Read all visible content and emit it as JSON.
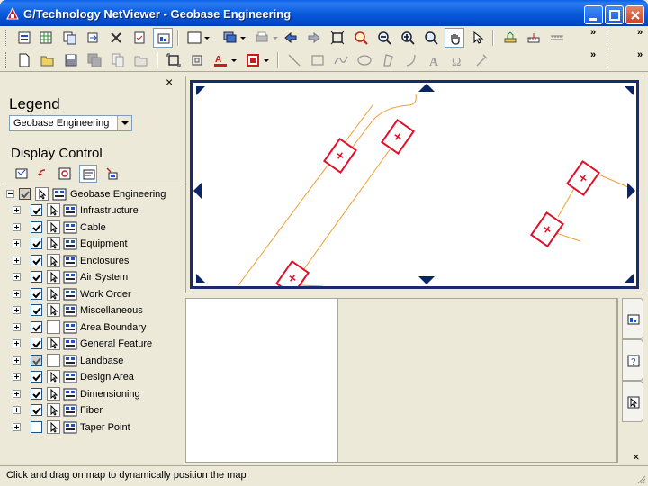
{
  "window": {
    "title": "G/Technology NetViewer - Geobase Engineering"
  },
  "toolbar1": {
    "icons": [
      "doc-properties-icon",
      "spreadsheet-icon",
      "copy-icon",
      "export-icon",
      "tools-icon",
      "report-icon",
      "view-icon",
      "select-rect-icon",
      "layers-icon",
      "print-icon",
      "back-arrow-icon",
      "forward-arrow-icon",
      "fit-icon",
      "zoom-area-icon",
      "zoom-out-icon",
      "zoom-in-icon",
      "zoom-magnify-icon",
      "pan-tool-icon",
      "pointer-icon",
      "measure-icon",
      "tape-icon",
      "ruler-icon"
    ],
    "overflow": "»"
  },
  "toolbar2": {
    "icons": [
      "new-icon",
      "open-icon",
      "save-icon",
      "save-all-icon",
      "copy-doc-icon",
      "folder-icon",
      "fit-frame-icon",
      "clip-icon",
      "text-style-icon",
      "fill-style-icon",
      "line-icon",
      "rectangle-icon",
      "polyline-icon",
      "ellipse-icon",
      "freehand-icon",
      "arc-icon",
      "text-icon",
      "symbol-icon",
      "stamp-icon"
    ],
    "overflow": "»"
  },
  "legend": {
    "close": "×",
    "title": "Legend",
    "selected": "Geobase Engineering"
  },
  "display_control": {
    "title": "Display Control",
    "root": {
      "label": "Geobase Engineering",
      "visible": true,
      "selectable": true
    },
    "items": [
      {
        "label": "Infrastructure",
        "visible": true,
        "selectable": true
      },
      {
        "label": "Cable",
        "visible": true,
        "selectable": true
      },
      {
        "label": "Equipment",
        "visible": true,
        "selectable": true
      },
      {
        "label": "Enclosures",
        "visible": true,
        "selectable": true
      },
      {
        "label": "Air System",
        "visible": true,
        "selectable": true
      },
      {
        "label": "Work Order",
        "visible": true,
        "selectable": true
      },
      {
        "label": "Miscellaneous",
        "visible": true,
        "selectable": true
      },
      {
        "label": "Area Boundary",
        "visible": true,
        "selectable": false
      },
      {
        "label": "General Feature",
        "visible": true,
        "selectable": true
      },
      {
        "label": "Landbase",
        "visible": true,
        "selectable": false
      },
      {
        "label": "Design Area",
        "visible": true,
        "selectable": true
      },
      {
        "label": "Dimensioning",
        "visible": true,
        "selectable": true
      },
      {
        "label": "Fiber",
        "visible": true,
        "selectable": true
      },
      {
        "label": "Taper Point",
        "visible": false,
        "selectable": true
      }
    ]
  },
  "lower_pane": {
    "close": "×"
  },
  "status": {
    "text": "Click and drag on map to dynamically position the map"
  },
  "colors": {
    "title_bar": "#0A5BDC",
    "map_frame": "#1A2A6E",
    "map_line": "#F0A030",
    "feature": "#E0102A"
  }
}
